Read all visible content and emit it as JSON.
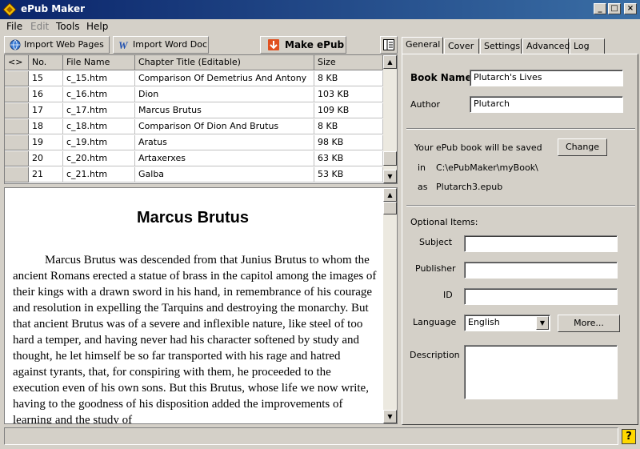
{
  "window": {
    "title": "ePub Maker"
  },
  "menu": [
    "File",
    "Edit",
    "Tools",
    "Help"
  ],
  "toolbar": {
    "import_web": "Import Web Pages",
    "import_word": "Import Word Doc",
    "make_epub": "Make ePub"
  },
  "grid": {
    "headers": [
      "<>",
      "No.",
      "File Name",
      "Chapter Title (Editable)",
      "Size"
    ],
    "rows": [
      [
        "15",
        "c_15.htm",
        "Comparison Of Demetrius And Antony",
        "8 KB"
      ],
      [
        "16",
        "c_16.htm",
        "Dion",
        "103 KB"
      ],
      [
        "17",
        "c_17.htm",
        "Marcus Brutus",
        "109 KB"
      ],
      [
        "18",
        "c_18.htm",
        "Comparison Of Dion And Brutus",
        "8 KB"
      ],
      [
        "19",
        "c_19.htm",
        "Aratus",
        "98 KB"
      ],
      [
        "20",
        "c_20.htm",
        "Artaxerxes",
        "63 KB"
      ],
      [
        "21",
        "c_21.htm",
        "Galba",
        "53 KB"
      ]
    ]
  },
  "preview": {
    "title": "Marcus Brutus",
    "body": "Marcus Brutus was descended from that Junius Brutus to whom the ancient Romans erected a statue of brass in the capitol among the images of their kings with a drawn sword in his hand, in remembrance of his courage and resolution in expelling the Tarquins and destroying the monarchy. But that ancient Brutus was of a severe and inflexible nature, like steel of too hard a temper, and having never had his character softened by study and thought, he let himself be so far transported with his rage and hatred against tyrants, that, for conspiring with them, he proceeded to the execution even of his own sons. But this Brutus, whose life we now write, having to the goodness of his disposition added the improvements of learning and the study of"
  },
  "tabs": [
    "General",
    "Cover",
    "Settings",
    "Advanced",
    "Log"
  ],
  "general": {
    "book_name_label": "Book Name",
    "book_name": "Plutarch's Lives",
    "author_label": "Author",
    "author": "Plutarch",
    "save_text": "Your ePub book will be saved",
    "change": "Change",
    "in_label": "in",
    "path": "C:\\ePubMaker\\myBook\\",
    "as_label": "as",
    "filename": "Plutarch3.epub",
    "optional": "Optional Items:",
    "subject": "Subject",
    "publisher": "Publisher",
    "id": "ID",
    "language": "Language",
    "language_value": "English",
    "more": "More...",
    "description": "Description"
  },
  "colors": {
    "titlebar_start": "#0a246a",
    "titlebar_end": "#3a6ea5",
    "make_icon": "#e05020"
  }
}
